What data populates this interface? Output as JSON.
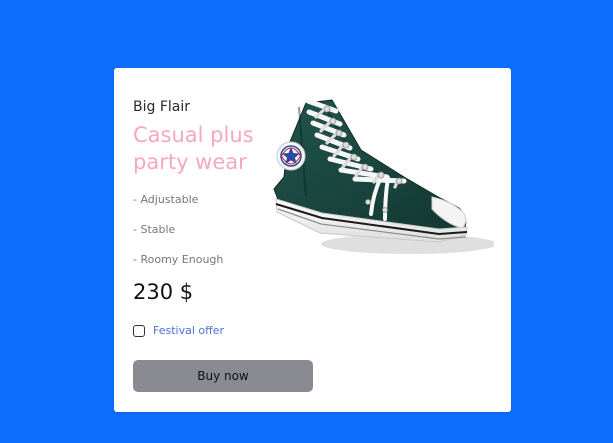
{
  "product": {
    "brand": "Big Flair",
    "title": "Casual plus party wear",
    "features": [
      "- Adjustable",
      "- Stable",
      "- Roomy Enough"
    ],
    "price": "230 $",
    "offer_label": "Festival offer",
    "offer_checked": false,
    "buy_label": "Buy now",
    "image_icon": "sneaker-image"
  },
  "colors": {
    "background": "#0d6efd",
    "card": "#ffffff",
    "title": "#f7a8be",
    "button": "#8a8a93",
    "offer_text": "#4f6fd8",
    "shoe_canvas": "#173f3a"
  }
}
